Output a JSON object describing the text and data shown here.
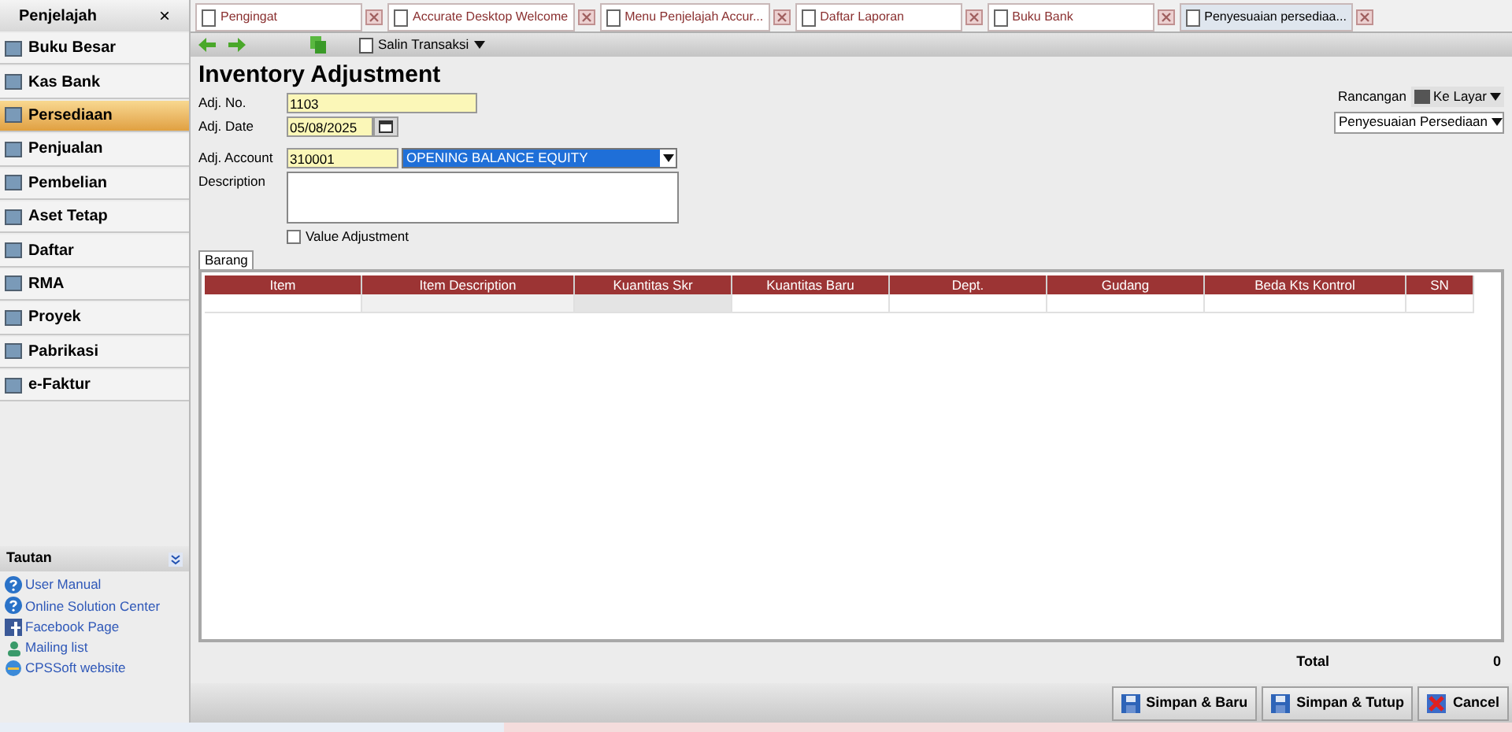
{
  "sidebar": {
    "title": "Penjelajah",
    "close": "×",
    "items": [
      {
        "label": "Buku Besar",
        "selected": false
      },
      {
        "label": "Kas Bank",
        "selected": false
      },
      {
        "label": "Persediaan",
        "selected": true
      },
      {
        "label": "Penjualan",
        "selected": false
      },
      {
        "label": "Pembelian",
        "selected": false
      },
      {
        "label": "Aset Tetap",
        "selected": false
      },
      {
        "label": "Daftar",
        "selected": false
      },
      {
        "label": "RMA",
        "selected": false
      },
      {
        "label": "Proyek",
        "selected": false
      },
      {
        "label": "Pabrikasi",
        "selected": false
      },
      {
        "label": "e-Faktur",
        "selected": false
      }
    ],
    "links_title": "Tautan",
    "links": [
      {
        "label": "User Manual",
        "kind": "help"
      },
      {
        "label": "Online Solution Center",
        "kind": "help"
      },
      {
        "label": "Facebook Page",
        "kind": "facebook"
      },
      {
        "label": "Mailing list",
        "kind": "mail"
      },
      {
        "label": "CPSSoft website",
        "kind": "web"
      }
    ]
  },
  "tabs": [
    {
      "label": "Pengingat",
      "selected": false
    },
    {
      "label": "Accurate Desktop Welcome",
      "selected": false
    },
    {
      "label": "Menu Penjelajah Accur...",
      "selected": false
    },
    {
      "label": "Daftar Laporan",
      "selected": false
    },
    {
      "label": "Buku Bank",
      "selected": false
    },
    {
      "label": "Penyesuaian persediaa...",
      "selected": true
    }
  ],
  "toolbar": {
    "copy": "Salin Transaksi"
  },
  "form": {
    "title": "Inventory Adjustment",
    "no_label": "Adj. No.",
    "no": "1103",
    "date_label": "Adj. Date",
    "date": "05/08/2025",
    "account_label": "Adj. Account",
    "account": "310001",
    "account_name": "OPENING BALANCE EQUITY",
    "description_label": "Description",
    "value_adjustment": {
      "label": "Value Adjustment",
      "checked": false
    },
    "design_label": "Rancangan",
    "design_target": "Ke Layar",
    "design": "Penyesuaian Persediaan"
  },
  "grid": {
    "tab": "Barang",
    "columns": [
      "Item",
      "Item Description",
      "Kuantitas Skr",
      "Kuantitas Baru",
      "Dept.",
      "Gudang",
      "Beda Kts Kontrol",
      "SN"
    ]
  },
  "total": {
    "label": "Total",
    "value": "0"
  },
  "buttons": [
    {
      "label": "Simpan & Baru",
      "kind": "save-new"
    },
    {
      "label": "Simpan & Tutup",
      "kind": "save-close"
    },
    {
      "label": "Cancel",
      "kind": "cancel"
    }
  ]
}
